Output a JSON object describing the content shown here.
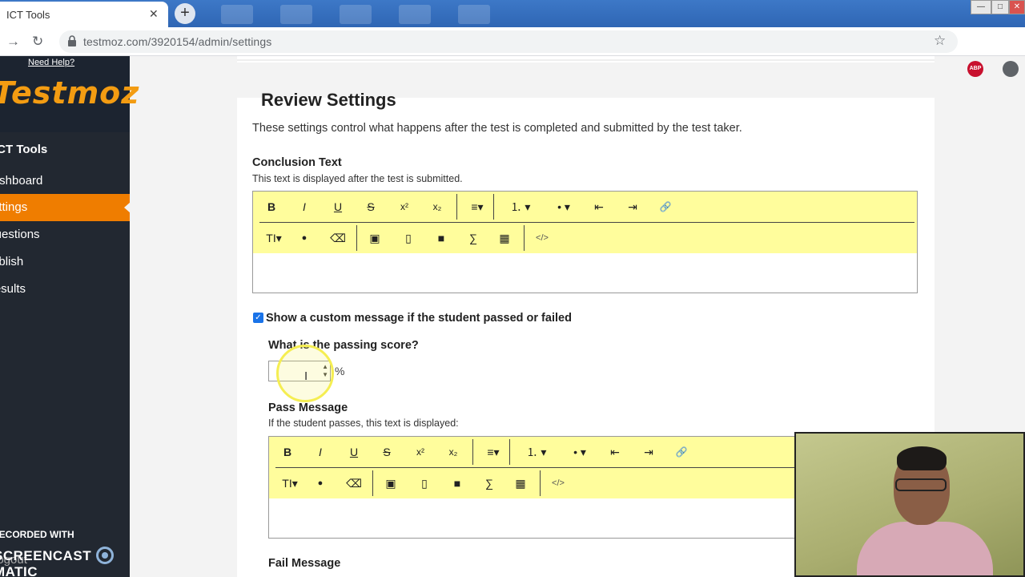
{
  "browser": {
    "tab_title": "ICT Tools",
    "tab_close": "✕",
    "new_tab": "+",
    "url": "testmoz.com/3920154/admin/settings",
    "abp_label": "ABP"
  },
  "sidebar": {
    "need_help": "Need Help?",
    "logo": "Testmoz",
    "section_title": "ICT Tools",
    "items": [
      {
        "label": "Dashboard"
      },
      {
        "label": "Settings"
      },
      {
        "label": "Questions"
      },
      {
        "label": "Publish"
      },
      {
        "label": "Results"
      }
    ],
    "logout": "Logout"
  },
  "watermark": {
    "line1": "RECORDED WITH",
    "line2a": "SCREENCAST",
    "line2b": "MATIC"
  },
  "review": {
    "title": "Review Settings",
    "description": "These settings control what happens after the test is completed and submitted by the test taker.",
    "conclusion": {
      "label": "Conclusion Text",
      "sublabel": "This text is displayed after the test is submitted."
    },
    "custom_message": {
      "checked": true,
      "label": "Show a custom message if the student passed or failed"
    },
    "passing_score": {
      "label": "What is the passing score?",
      "value": "",
      "unit": "%"
    },
    "pass_message": {
      "label": "Pass Message",
      "sublabel": "If the student passes, this text is displayed:"
    },
    "fail_message": {
      "label": "Fail Message"
    }
  },
  "toolbar": {
    "bold": "B",
    "italic": "I",
    "underline": "U",
    "strike": "S",
    "superscript": "x²",
    "subscript": "x₂",
    "align": "≡▾",
    "ordered_list": "⒈ ▾",
    "bullet_list": "• ▾",
    "outdent": "⇤",
    "indent": "⇥",
    "link": "🔗",
    "text_size": "TI▾",
    "color": "●",
    "eraser": "⌫",
    "image": "▣",
    "file": "▯",
    "video": "■",
    "formula": "∑",
    "table": "▦",
    "code": "</>"
  }
}
